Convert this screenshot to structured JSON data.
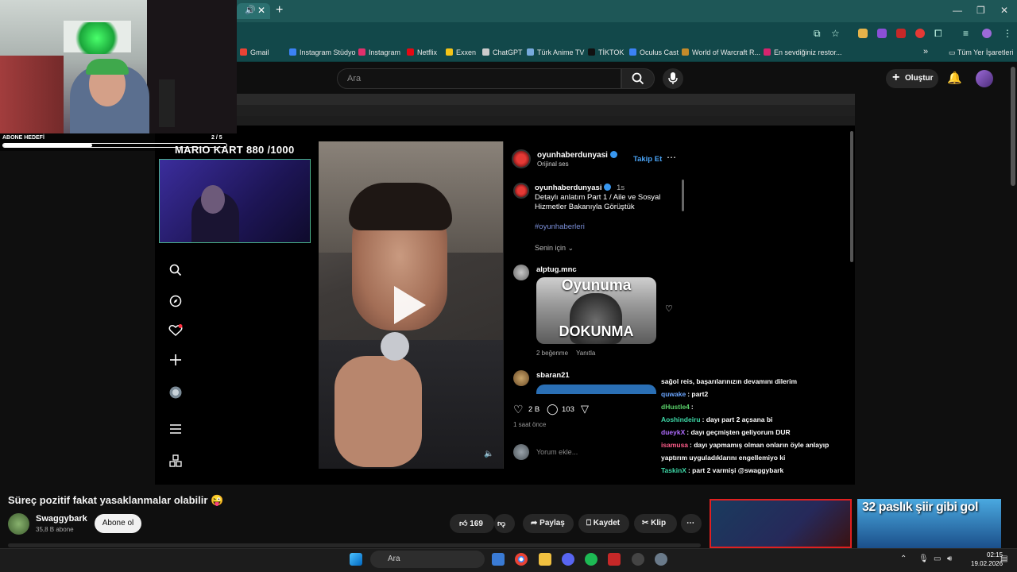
{
  "browser": {
    "bookmarks": [
      {
        "label": "Gmail",
        "color": "#ea4335"
      },
      {
        "label": "Instagram Stüdyo",
        "color": "#3b82f6"
      },
      {
        "label": "Instagram",
        "color": "#e1306c"
      },
      {
        "label": "Netflix",
        "color": "#e50914"
      },
      {
        "label": "Exxen",
        "color": "#f5c518"
      },
      {
        "label": "ChatGPT",
        "color": "#cccccc"
      },
      {
        "label": "Türk Anime TV",
        "color": "#7ad"
      },
      {
        "label": "TİKTOK",
        "color": "#111111"
      },
      {
        "label": "Oculus Cast",
        "color": "#3b82f6"
      },
      {
        "label": "World of Warcraft R...",
        "color": "#c58b2a"
      },
      {
        "label": "En sevdiğiniz restor...",
        "color": "#d6246e"
      }
    ],
    "overflow_label": "»",
    "all_bookmarks_label": "Tüm Yer İşaretleri"
  },
  "youtube": {
    "search_placeholder": "Ara",
    "create_label": "Oluştur",
    "video_title": "Süreç pozitif fakat yasaklanmalar olabilir 😜",
    "channel_name": "Swaggybark",
    "channel_subs": "35,8 B abone",
    "subscribe_label": "Abone ol",
    "like_count": "169",
    "share_label": "Paylaş",
    "save_label": "Kaydet",
    "clip_label": "Klip",
    "rec2_title": "32 paslık şiir gibi gol"
  },
  "overlay": {
    "goal_label": "ABONE HEDEFİ",
    "goal_count": "2 / 5",
    "goal_progress": 0.4,
    "mario_kart": "MARIO KART   880 /1000"
  },
  "instagram": {
    "author": "oyunhaberdunyasi",
    "audio": "Orijinal ses",
    "follow_label": "Takip Et",
    "caption_author": "oyunhaberdunyasi",
    "caption_time": "1s",
    "caption_text_1": "Detaylı anlatım Part 1 / Aile ve Sosyal",
    "caption_text_2": "Hizmetler Bakanıyla Görüştük",
    "hashtag": "#oyunhaberleri",
    "for_you": "Senin için",
    "comment1_user": "alptug.mnc",
    "thumb_top": "Oyunuma",
    "thumb_bottom": "DOKUNMA",
    "comment1_likes": "2 beğenme",
    "reply_label": "Yanıtla",
    "comment2_user": "sbaran21",
    "likes": "2 B",
    "comments": "103",
    "time_ago": "1 saat önce",
    "comment_placeholder": "Yorum ekle..."
  },
  "chat": [
    {
      "user": "",
      "msg": "sağol reis, başarılarınızın devamını dilerim",
      "color": "#ffffff"
    },
    {
      "user": "quwake",
      "msg": ": part2",
      "color": "#6aa5ff"
    },
    {
      "user": "dHustle4",
      "msg": ":",
      "color": "#5ad16a"
    },
    {
      "user": "Aoshindeiru",
      "msg": ": dayı part 2 açsana bi",
      "color": "#3dd6a6"
    },
    {
      "user": "dueykX",
      "msg": ": dayı geçmişten geliyorum DUR",
      "color": "#b06cff"
    },
    {
      "user": "isamusa",
      "msg": ": dayı yapmamış olman onların öyle anlayıp yaptırım uyguladıklarını engellemiyo ki",
      "color": "#ff5c8a"
    },
    {
      "user": "TaskinX",
      "msg": ": part 2 varmişi @swaggybark",
      "color": "#3dd6a6"
    }
  ],
  "taskbar": {
    "search_label": "Ara",
    "time": "02:15",
    "date": "19.02.2026"
  }
}
